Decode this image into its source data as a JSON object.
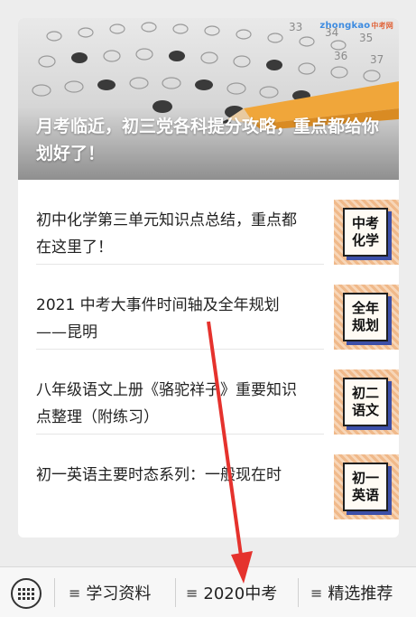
{
  "hero": {
    "title": "月考临近，初三党各科提分攻略，重点都给你划好了！",
    "brand": "zhongkao",
    "brand_cn": "中考网"
  },
  "articles": [
    {
      "title": "初中化学第三单元知识点总结，重点都在这里了！",
      "thumb_label": "中考化学"
    },
    {
      "title": "2021 中考大事件时间轴及全年规划——昆明",
      "thumb_label": "全年规划"
    },
    {
      "title": "八年级语文上册《骆驼祥子》重要知识点整理（附练习）",
      "thumb_label": "初二语文"
    },
    {
      "title": "初一英语主要时态系列：一般现在时",
      "thumb_label": "初一英语"
    }
  ],
  "bottom_menu": {
    "items": [
      "学习资料",
      "2020中考",
      "精选推荐"
    ],
    "menu_icon": "hamburger-icon",
    "keyboard_icon": "keyboard-icon"
  },
  "colors": {
    "accent_arrow": "#e5322d",
    "thumb_stripe": "#f0b98a",
    "thumb_shadow": "#3c4fa8"
  }
}
